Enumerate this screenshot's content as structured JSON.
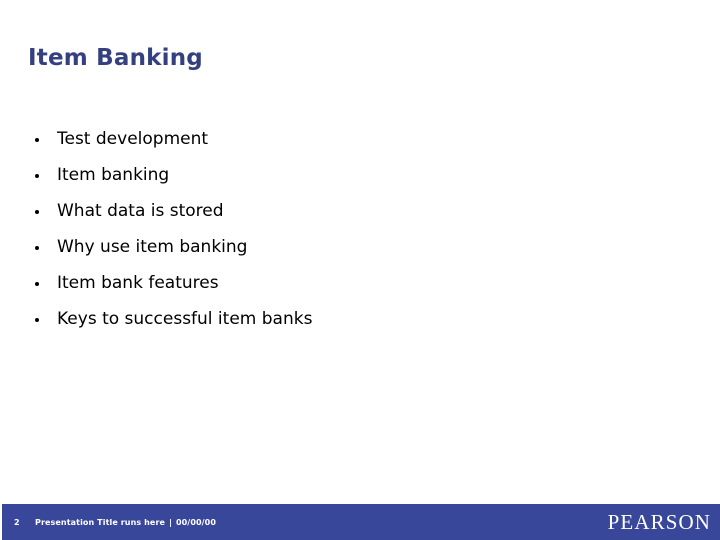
{
  "slide": {
    "title": "Item Banking",
    "bullets": [
      {
        "text": "Test development"
      },
      {
        "text": "Item banking"
      },
      {
        "text": "What data is stored"
      },
      {
        "text": "Why use item banking"
      },
      {
        "text": "Item bank features"
      },
      {
        "text": "Keys to successful item banks"
      }
    ]
  },
  "footer": {
    "slide_number": "2",
    "presentation_title": "Presentation Title runs here",
    "separator": "|",
    "date": "00/00/00",
    "brand": "PEARSON"
  },
  "colors": {
    "title": "#35417f",
    "footer_bar": "#39479b",
    "bullet": "#000000",
    "body_text": "#000000",
    "background": "#ffffff",
    "footer_text": "#ffffff"
  }
}
